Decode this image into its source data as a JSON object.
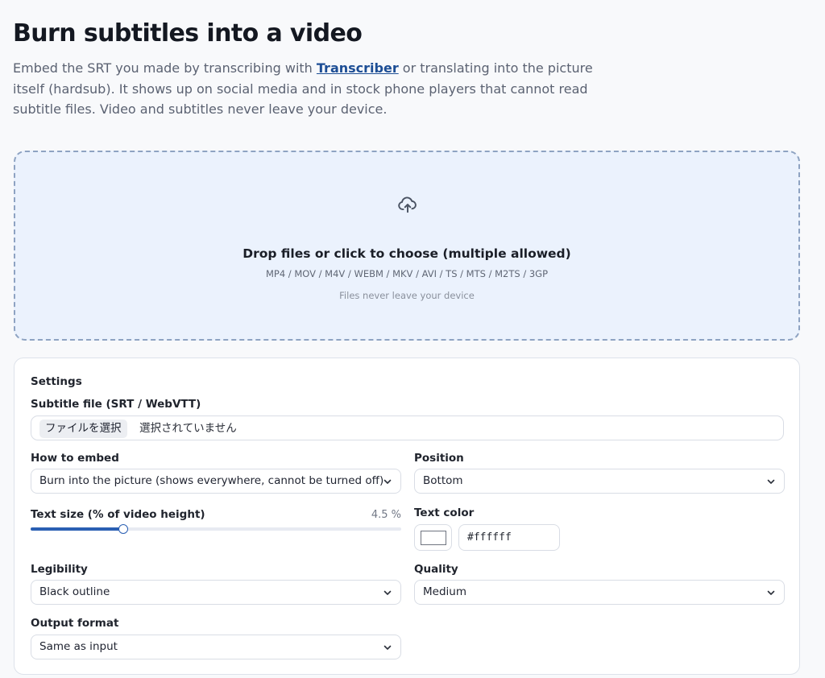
{
  "header": {
    "title": "Burn subtitles into a video",
    "intro_before": "Embed the SRT you made by transcribing with ",
    "intro_link": "Transcriber",
    "intro_after": " or translating into the picture itself (hardsub). It shows up on social media and in stock phone players that cannot read subtitle files. Video and subtitles never leave your device."
  },
  "dropzone": {
    "icon": "cloud-upload-icon",
    "title": "Drop files or click to choose (multiple allowed)",
    "formats": "MP4 / MOV / M4V / WEBM / MKV / AVI / TS / MTS / M2TS / 3GP",
    "note": "Files never leave your device"
  },
  "settings": {
    "heading": "Settings",
    "subtitle_file": {
      "label": "Subtitle file (SRT / WebVTT)",
      "button": "ファイルを選択",
      "status": "選択されていません"
    },
    "how_to_embed": {
      "label": "How to embed",
      "value": "Burn into the picture (shows everywhere, cannot be turned off)"
    },
    "position": {
      "label": "Position",
      "value": "Bottom"
    },
    "text_size": {
      "label": "Text size (% of video height)",
      "value_text": "4.5 %",
      "fill_fraction": 0.25
    },
    "text_color": {
      "label": "Text color",
      "value": "#ffffff",
      "swatch": "#ffffff"
    },
    "legibility": {
      "label": "Legibility",
      "value": "Black outline"
    },
    "quality": {
      "label": "Quality",
      "value": "Medium"
    },
    "output_format": {
      "label": "Output format",
      "value": "Same as input"
    }
  },
  "colors": {
    "accent": "#2a5fb3",
    "link": "#1d4e95",
    "dropzone_bg": "#ebf2fd",
    "dropzone_border": "#8ea3c2"
  }
}
